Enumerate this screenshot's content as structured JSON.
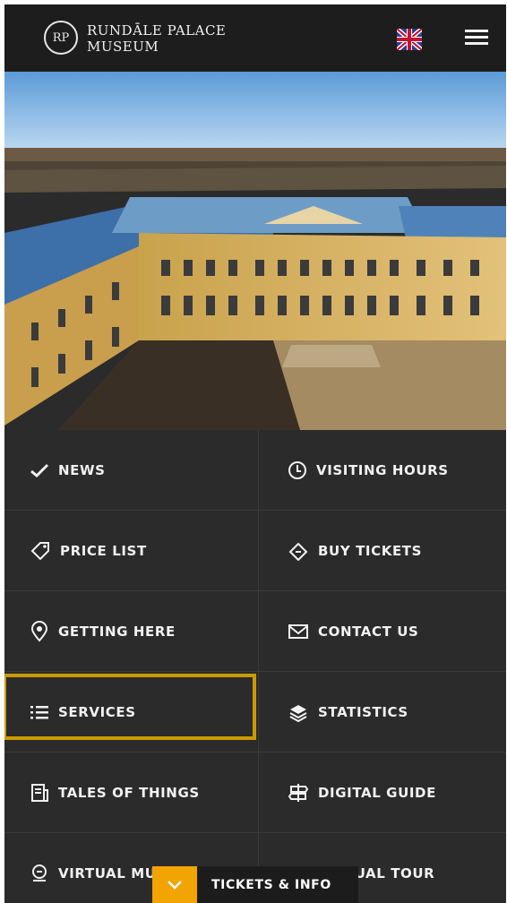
{
  "header": {
    "logo_monogram": "RP",
    "logo_line1": "Rundāle Palace",
    "logo_line2": "Museum",
    "language_icon": "uk-flag-icon",
    "menu_icon": "hamburger-menu-icon"
  },
  "hero": {
    "description_icon": "palace-photo"
  },
  "menu": {
    "news": "NEWS",
    "visiting_hours": "VISITING HOURS",
    "price_list": "PRICE LIST",
    "buy_tickets": "BUY TICKETS",
    "getting_here": "GETTING HERE",
    "contact_us": "CONTACT US",
    "services": "SERVICES",
    "statistics": "STATISTICS",
    "tales_of_things": "TALES OF THINGS",
    "digital_guide": "DIGITAL GUIDE",
    "virtual_museum": "VIRTUAL MUSEUM",
    "virtual_tour": "VIRTUAL TOUR"
  },
  "tickets_bar": {
    "label": "TICKETS & INFO"
  },
  "colors": {
    "accent": "#f2a400",
    "highlight": "#c99a00",
    "background": "#2b2b2b",
    "header": "#1d1d1d"
  }
}
